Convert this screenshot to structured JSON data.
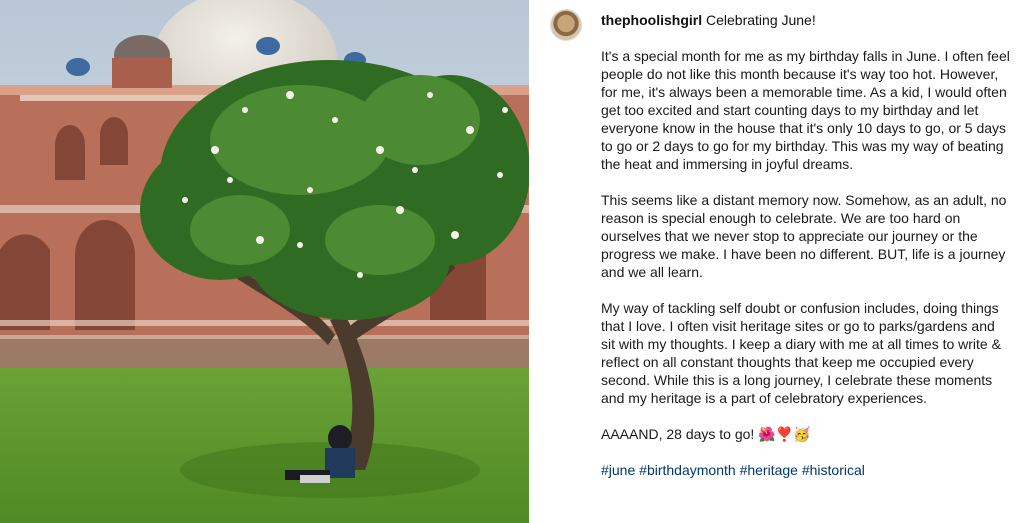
{
  "post": {
    "username": "thephoolishgirl",
    "title_text": " Celebrating June!",
    "paragraphs": [
      "It's a special month for me as my birthday falls in June. I often feel people do not like this month because it's way too hot. However, for me, it's always been a memorable time. As a kid, I would often get too excited and start counting days to my birthday and let everyone know in the house that it's only 10 days to go, or 5 days to go or 2 days to go for my birthday. This was my way of beating the heat and immersing in joyful dreams.",
      "This seems like a distant memory now. Somehow, as an adult, no reason is special enough to celebrate. We are too hard on ourselves that we never stop to appreciate our journey or the progress we make. I have been no different. BUT, life is a journey and we all learn.",
      "My way of tackling self doubt or confusion includes, doing things that I love. I often visit heritage sites or go to parks/gardens and sit with my thoughts. I keep a diary with me at all times to write & reflect on all constant thoughts that keep me occupied every second. While this is a long journey, I celebrate these moments and my heritage is a part of celebratory experiences.",
      "AAAAND, 28 days to go! 🌺❣️🥳"
    ],
    "hashtags": [
      "#june",
      "#birthdaymonth",
      "#heritage",
      "#historical"
    ]
  }
}
